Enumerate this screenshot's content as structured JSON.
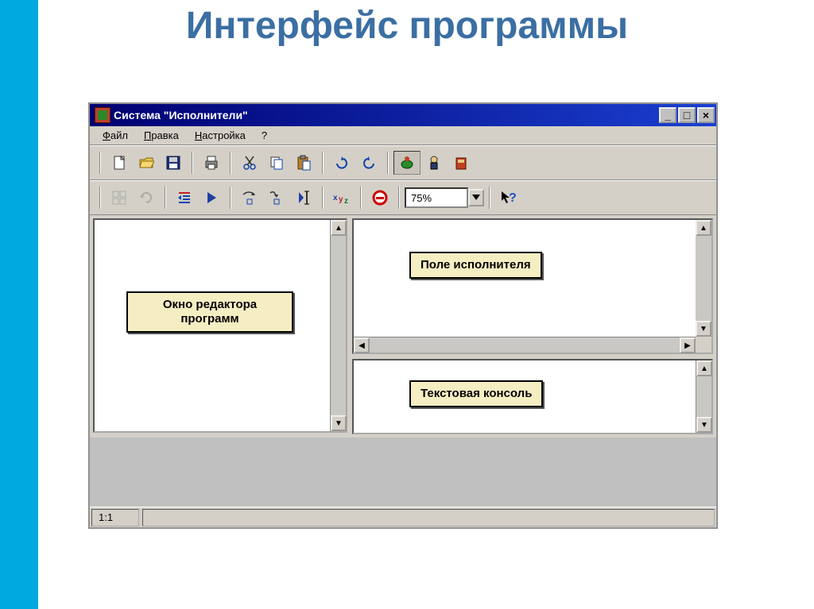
{
  "page_title": "Интерфейс программы",
  "window_title": "Система \"Исполнители\"",
  "menu": {
    "file": "Файл",
    "edit": "Правка",
    "settings": "Настройка",
    "help": "?"
  },
  "zoom_value": "75%",
  "status": {
    "position": "1:1"
  },
  "labels": {
    "editor": "Окно редактора программ",
    "field": "Поле исполнителя",
    "console": "Текстовая консоль"
  }
}
